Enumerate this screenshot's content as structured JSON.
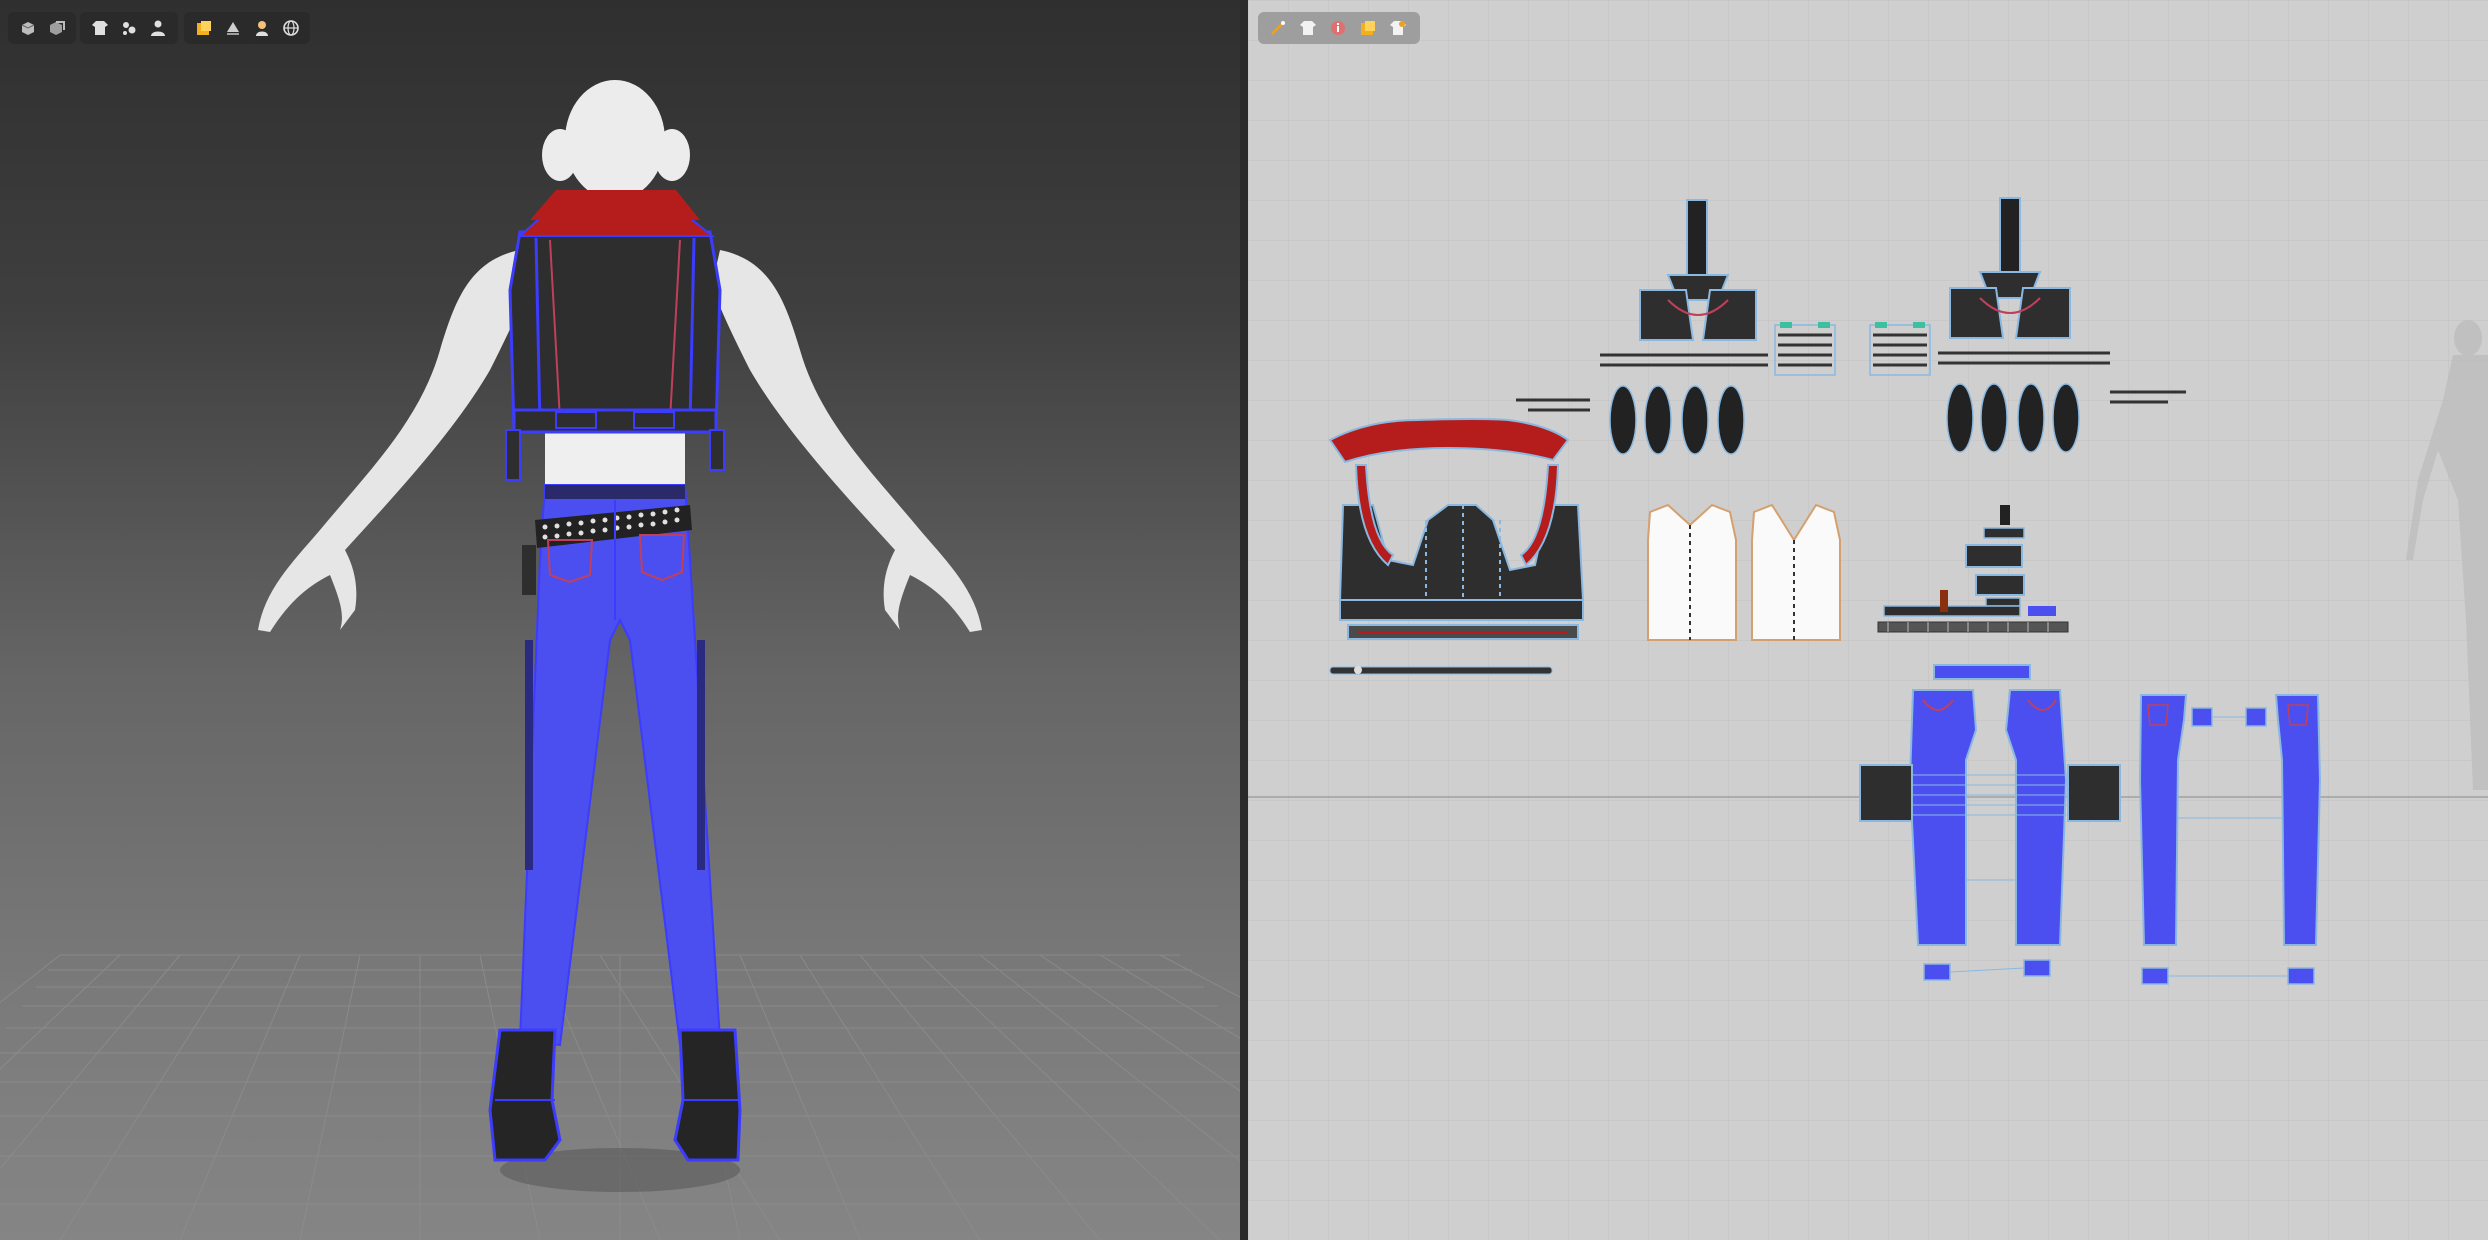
{
  "app": {
    "panels": [
      "3d-garment-window",
      "2d-pattern-window"
    ]
  },
  "colors": {
    "garment_blue": "#4b4ff0",
    "vest_black": "#2e2e2e",
    "collar_red": "#b51c1c",
    "seam_line": "#3c3cff",
    "topstitch": "#c0405a",
    "avatar": "#e8e8e8",
    "pattern_outline": "#8ab8e0"
  },
  "toolbar_3d": {
    "groups": [
      [
        "display-avatar-icon",
        "display-texture-icon"
      ],
      [
        "show-garment-icon",
        "garment-options-icon",
        "show-avatar-icon"
      ],
      [
        "folder-color-icon",
        "layer-icon",
        "person-avatar-icon",
        "globe-icon"
      ]
    ]
  },
  "toolbar_2d": {
    "tools": [
      "magic-wand-icon",
      "shirt-icon",
      "info-icon",
      "folder-color-icon",
      "shirt-texture-icon"
    ]
  }
}
